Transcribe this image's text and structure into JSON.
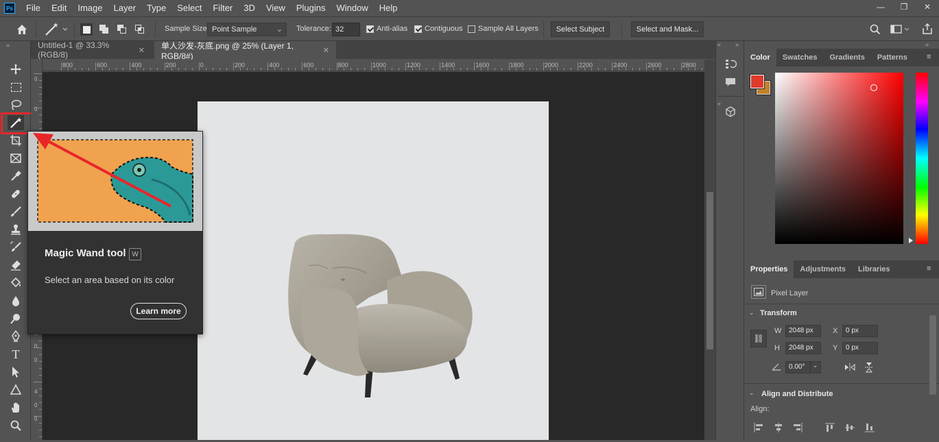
{
  "app": {
    "logo": "Ps"
  },
  "menu": [
    "File",
    "Edit",
    "Image",
    "Layer",
    "Type",
    "Select",
    "Filter",
    "3D",
    "View",
    "Plugins",
    "Window",
    "Help"
  ],
  "window_controls": {
    "minimize": "—",
    "restore": "❐",
    "close": "✕"
  },
  "options_bar": {
    "sample_size_label": "Sample Size:",
    "sample_size_value": "Point Sample",
    "tolerance_label": "Tolerance:",
    "tolerance_value": "32",
    "anti_alias_label": "Anti-alias",
    "anti_alias_checked": true,
    "contiguous_label": "Contiguous",
    "contiguous_checked": true,
    "sample_all_layers_label": "Sample All Layers",
    "sample_all_layers_checked": false,
    "select_subject_label": "Select Subject",
    "select_and_mask_label": "Select and Mask..."
  },
  "tabs": [
    {
      "label": "Untitled-1 @ 33.3% (RGB/8)",
      "active": false
    },
    {
      "label": "单人沙发-灰底.png @ 25% (Layer 1, RGB/8#)",
      "active": true
    }
  ],
  "ruler_h_labels": [
    "800",
    "600",
    "400",
    "200",
    "0",
    "200",
    "400",
    "600",
    "800",
    "1000",
    "1200",
    "1400",
    "1600",
    "1800",
    "2000",
    "2200",
    "2400",
    "2600",
    "2800"
  ],
  "ruler_v_labels": [
    "0",
    "0",
    "2",
    "0",
    "0",
    "4",
    "0",
    "0"
  ],
  "tooltip": {
    "title": "Magic Wand tool",
    "shortcut": "W",
    "description": "Select an area based on its color",
    "learn_more": "Learn more"
  },
  "color_panel": {
    "tabs": [
      "Color",
      "Swatches",
      "Gradients",
      "Patterns"
    ],
    "active_tab": "Color",
    "foreground": "#e03a2c",
    "background": "#c4812b"
  },
  "properties_panel": {
    "tabs": [
      "Properties",
      "Adjustments",
      "Libraries"
    ],
    "active_tab": "Properties",
    "layer_type": "Pixel Layer",
    "transform_title": "Transform",
    "w_label": "W",
    "w_value": "2048 px",
    "h_label": "H",
    "h_value": "2048 px",
    "x_label": "X",
    "x_value": "0 px",
    "y_label": "Y",
    "y_value": "0 px",
    "angle_value": "0.00°",
    "align_title": "Align and Distribute",
    "align_label": "Align:"
  },
  "colors": {
    "highlight_red": "#e8262a",
    "canvas_bg": "#e3e4e6",
    "tooltip_image_bg": "#f0a24f"
  }
}
